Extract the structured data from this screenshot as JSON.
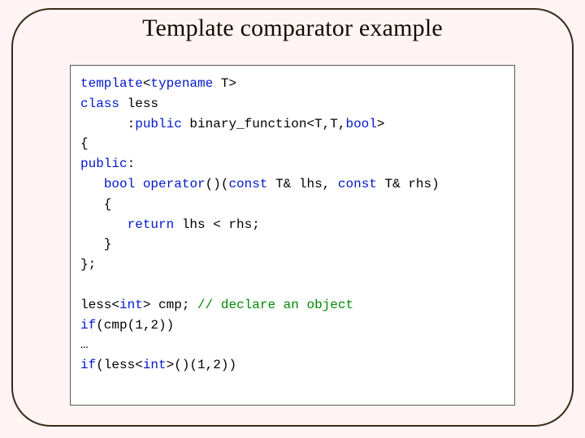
{
  "title": "Template comparator example",
  "code": {
    "l1a": "template",
    "l1b": "<",
    "l1c": "typename",
    "l1d": " T>",
    "l2a": "class",
    "l2b": " less",
    "l3a": "      :",
    "l3b": "public",
    "l3c": " binary_function<T,T,",
    "l3d": "bool",
    "l3e": ">",
    "l4": "{",
    "l5a": "public",
    "l5b": ":",
    "l6a": "   ",
    "l6b": "bool",
    "l6c": " ",
    "l6d": "operator",
    "l6e": "()(",
    "l6f": "const",
    "l6g": " T& lhs, ",
    "l6h": "const",
    "l6i": " T& rhs)",
    "l7": "   {",
    "l8a": "      ",
    "l8b": "return",
    "l8c": " lhs < rhs;",
    "l9": "   }",
    "l10": "};",
    "blank": "",
    "l11a": "less<",
    "l11b": "int",
    "l11c": "> cmp; ",
    "l11d": "// declare an object",
    "l12a": "if",
    "l12b": "(cmp(1,2))",
    "l13": "…",
    "l14a": "if",
    "l14b": "(less<",
    "l14c": "int",
    "l14d": ">()(1,2))"
  }
}
